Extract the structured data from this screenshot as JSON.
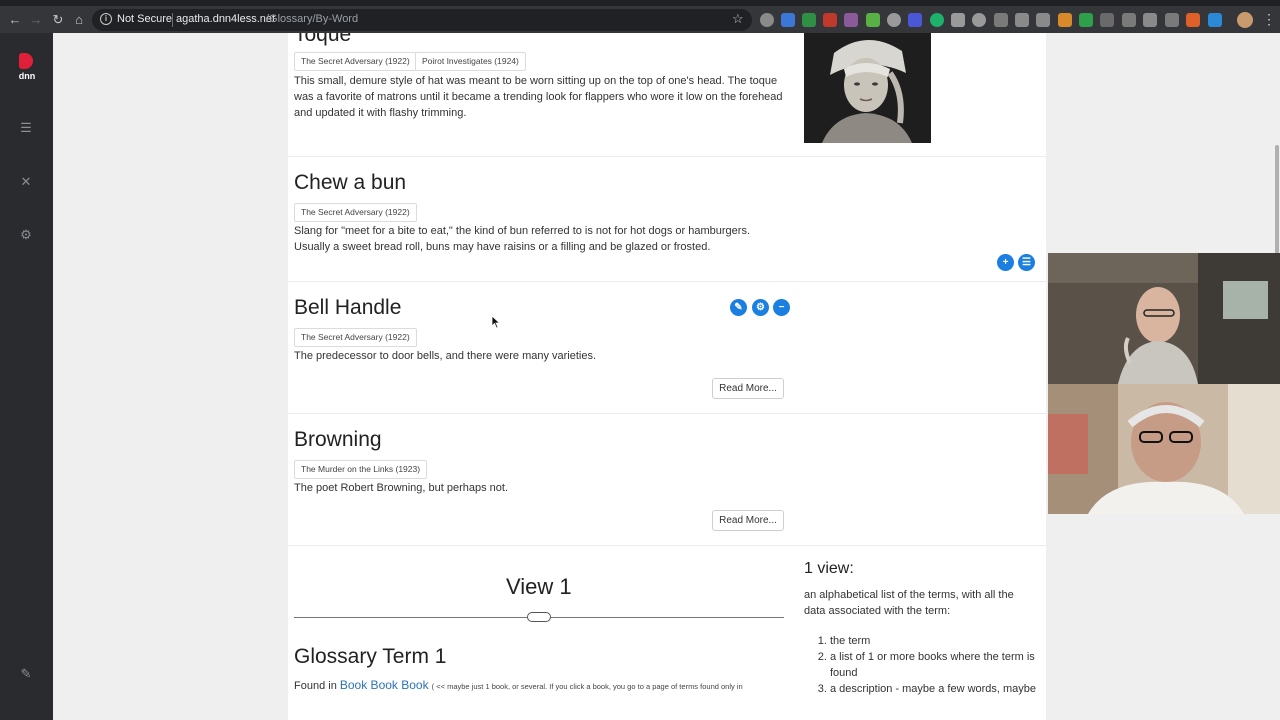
{
  "browser": {
    "security_label": "Not Secure",
    "url_host": "agatha.dnn4less.net",
    "url_path": "/Glossary/By-Word"
  },
  "terms": [
    {
      "title": "Toque",
      "books": [
        "The Secret Adversary (1922)",
        "Poirot Investigates (1924)"
      ],
      "description": "This small, demure style of hat was meant to be worn sitting up on the top of one's head. The toque was a favorite of matrons until it became a trending look for flappers who wore it low on the forehead and updated it with flashy trimming."
    },
    {
      "title": "Chew a bun",
      "books": [
        "The Secret Adversary (1922)"
      ],
      "description": "Slang for \"meet for a bite to eat,\" the kind of bun referred to is not for hot dogs or hamburgers. Usually a sweet bread roll, buns may have raisins or a filling and be glazed or frosted."
    },
    {
      "title": "Bell Handle",
      "books": [
        "The Secret Adversary (1922)"
      ],
      "description": "The predecessor to door bells, and there were many varieties.",
      "read_more": "Read More..."
    },
    {
      "title": "Browning",
      "books": [
        "The Murder on the Links (1923)"
      ],
      "description": "The poet Robert Browning, but perhaps not.",
      "read_more": "Read More..."
    }
  ],
  "mockup": {
    "view_title": "View 1",
    "glossary_term": "Glossary Term 1",
    "found_in_label": "Found in",
    "found_in_links": "Book Book Book",
    "found_in_note": "( << maybe just 1 book, or several. If you click a book, you go to a page of terms found only in"
  },
  "sidebar_note": {
    "heading": "1 view:",
    "intro": "an alphabetical list of the terms, with all the data associated with the term:",
    "items": [
      "the term",
      "a list of 1 or more books where the term is found",
      "a description - maybe a few words, maybe"
    ]
  },
  "icons": {
    "edit": "pencil-icon",
    "settings": "gear-icon",
    "delete": "minus-circle-icon",
    "add": "plus-icon",
    "list": "list-icon"
  }
}
